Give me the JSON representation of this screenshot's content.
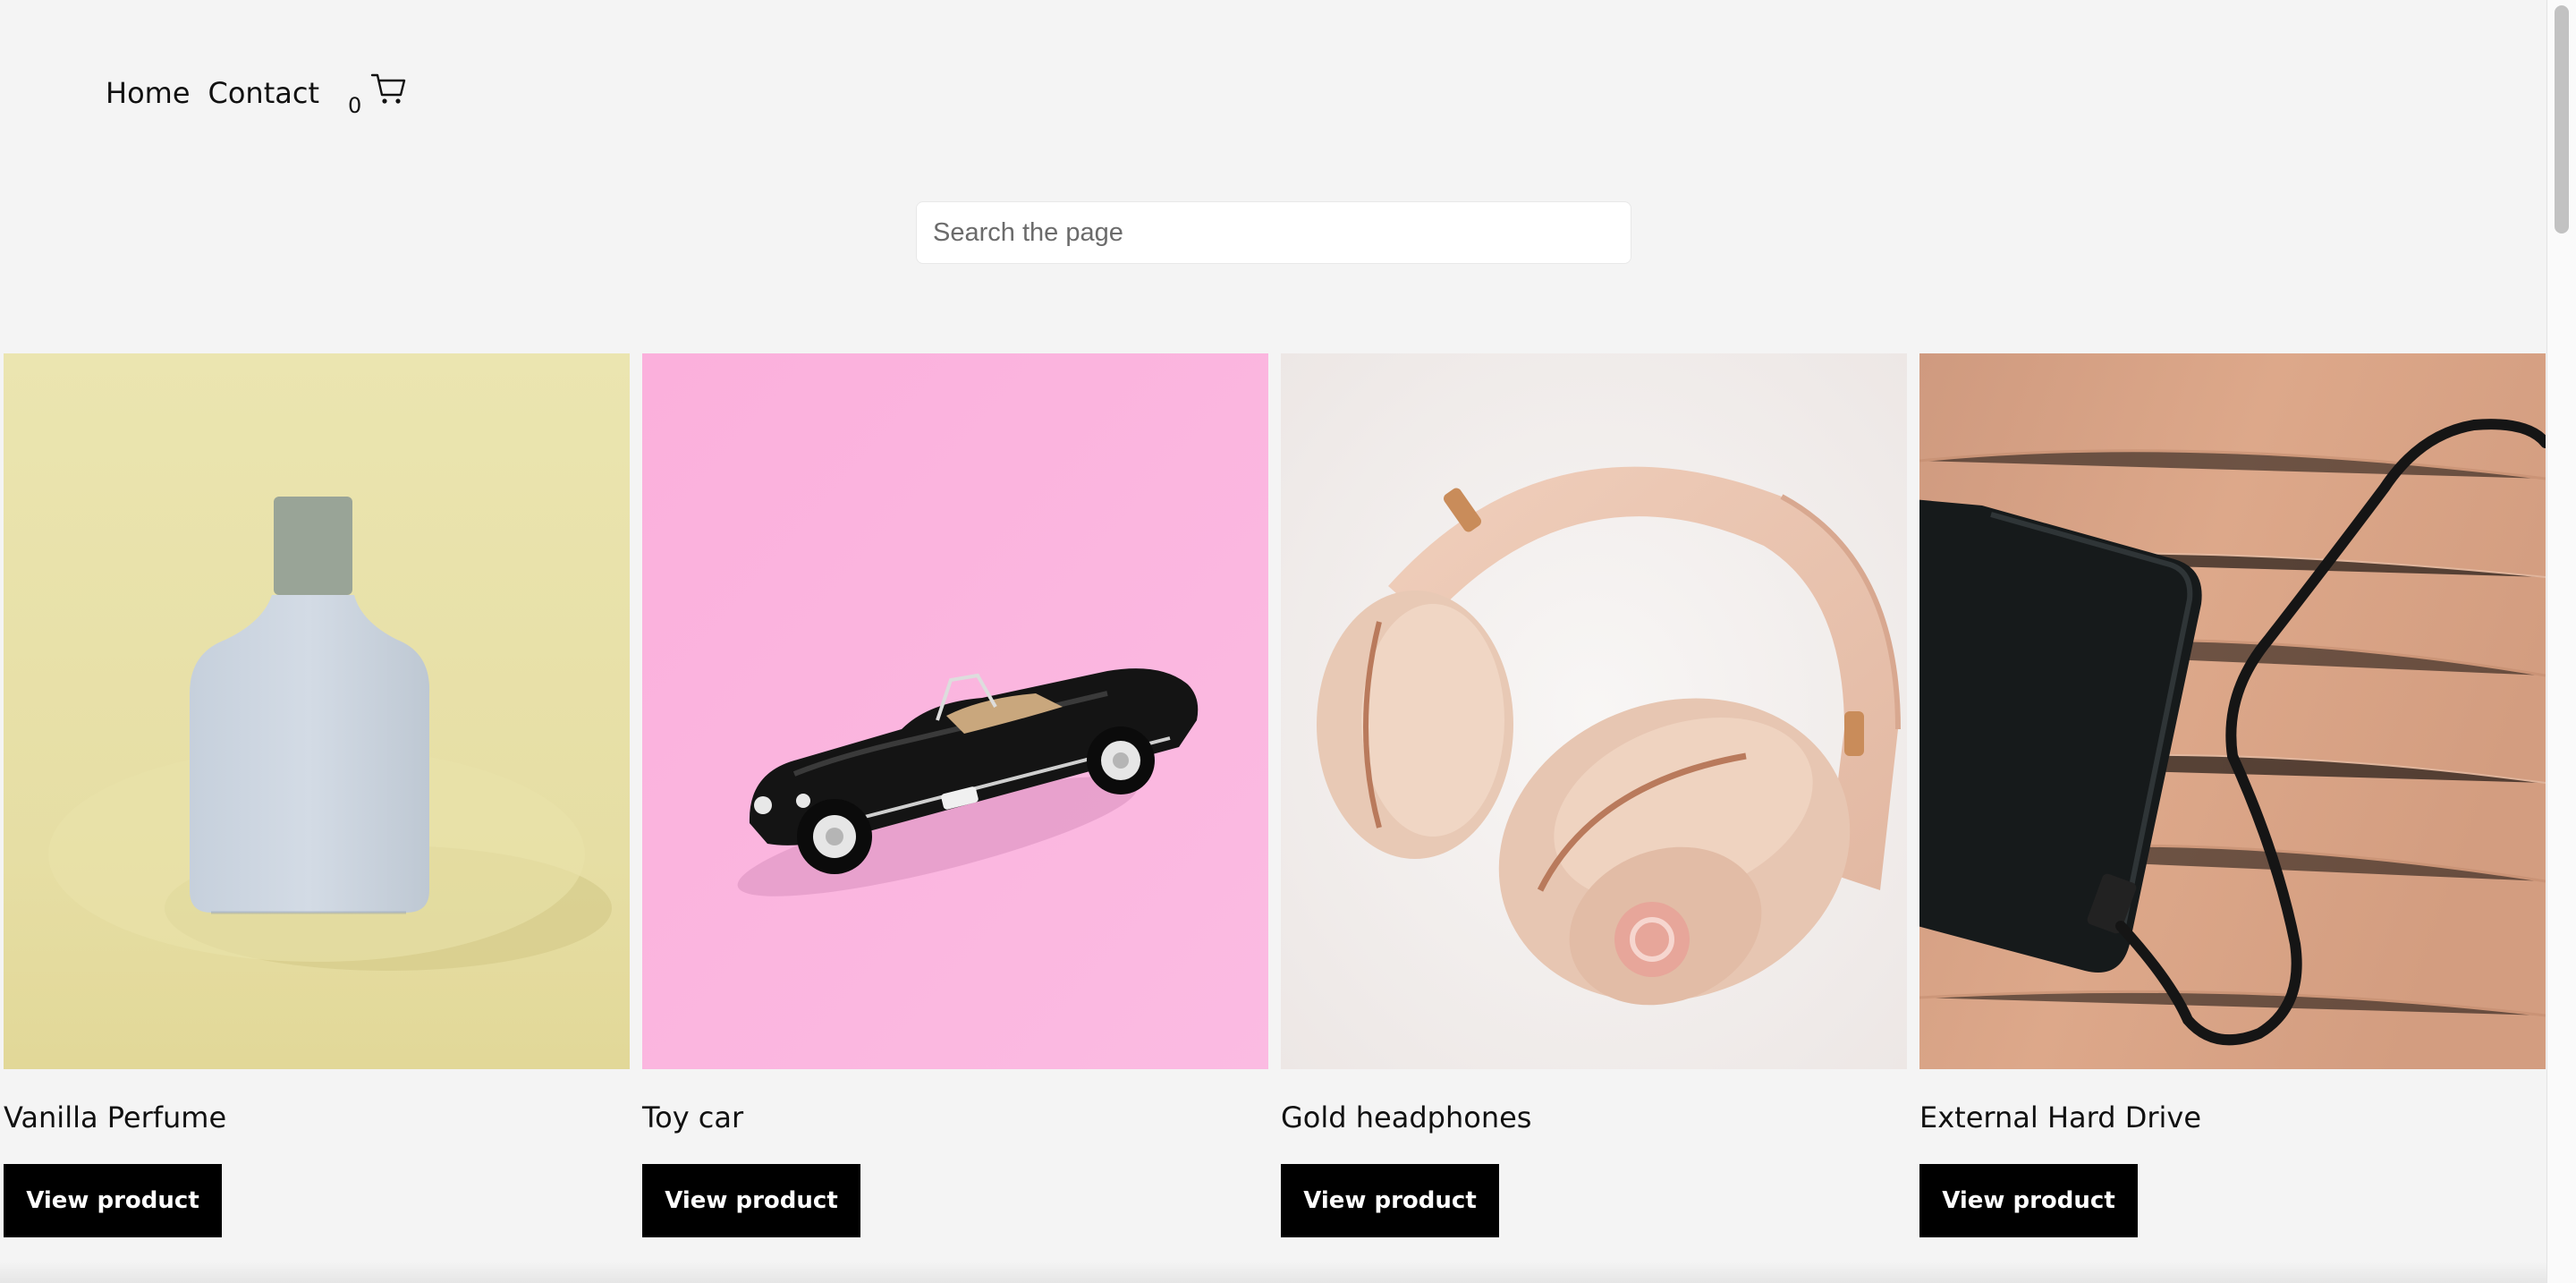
{
  "nav": {
    "links": [
      "Home",
      "Contact"
    ],
    "cart_count": "0",
    "cart_icon": "cart-icon"
  },
  "search": {
    "placeholder": "Search the page",
    "value": ""
  },
  "products": [
    {
      "title": "Vanilla Perfume",
      "button": "View product",
      "bg": "#e8e2ab"
    },
    {
      "title": "Toy car",
      "button": "View product",
      "bg": "#f9b3de"
    },
    {
      "title": "Gold headphones",
      "button": "View product",
      "bg": "#f1ecea"
    },
    {
      "title": "External Hard Drive",
      "button": "View product",
      "bg": "#d99f7f"
    }
  ],
  "colors": {
    "background": "#f4f4f4",
    "button": "#000000",
    "button_text": "#ffffff"
  }
}
